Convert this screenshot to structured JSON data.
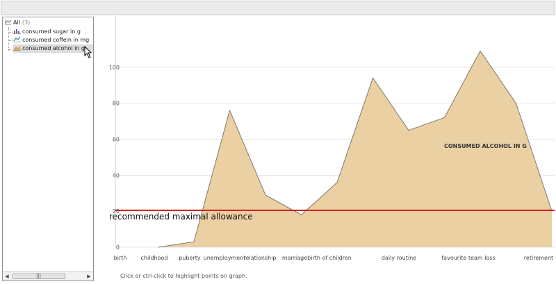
{
  "tree": {
    "root": {
      "label": "All",
      "count": "(3)"
    },
    "items": [
      {
        "label": "consumed sugar in g",
        "icon": "bar-chart-icon",
        "color": "#7b5fa8"
      },
      {
        "label": "consumed coffein in mg",
        "icon": "line-chart-icon",
        "color": "#2e8b8b"
      },
      {
        "label": "consumed alcohol in g",
        "icon": "area-chart-icon",
        "color": "#e0a860"
      }
    ],
    "selected_index": 2
  },
  "hint": "Click or ctrl-click to highlight points on graph.",
  "chart_data": {
    "type": "area",
    "categories": [
      "birth",
      "childhood",
      "puberty",
      "unemployment",
      "relationship",
      "marriage",
      "birth of children",
      "",
      "daily routine",
      "",
      "favourite team loss",
      "",
      "retirement"
    ],
    "series": [
      {
        "name": "CONSUMED ALCOHOL IN G",
        "values": [
          null,
          0,
          3,
          76,
          29,
          18,
          36,
          94,
          65,
          72,
          109,
          80,
          20
        ],
        "color": "#ebd0a4",
        "stroke": "#7f7766"
      }
    ],
    "reference_lines": [
      {
        "value": 20.5,
        "label": "recommended maximal allowance",
        "color": "#cc1a14"
      }
    ],
    "y_ticks": [
      0,
      20,
      40,
      60,
      80,
      100
    ],
    "ylim": [
      0,
      120
    ],
    "grid": true
  }
}
